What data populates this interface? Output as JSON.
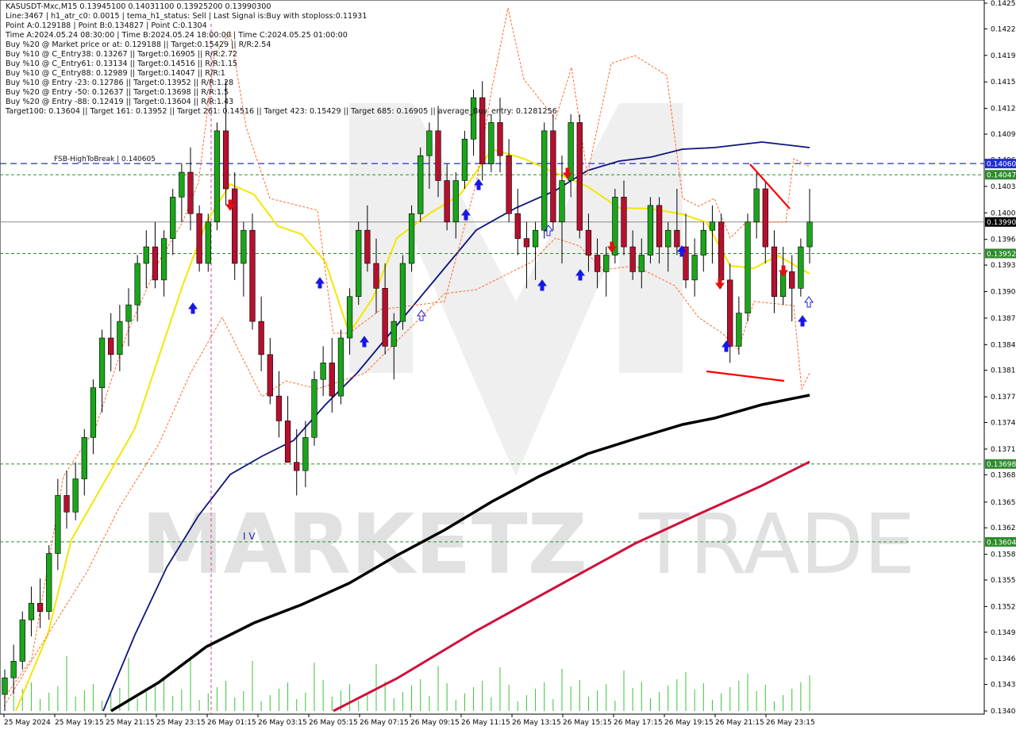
{
  "header": {
    "lines": [
      "KASUSDT-Mxc,M15  0.13945100 0.14031100 0.13925200 0.13990300",
      "Line:3467  |  h1_atr_c0: 0.0015  |  tema_h1_status: Sell  |  Last Signal is:Buy with stoploss:0.11931",
      "Point A:0.129188  |  Point B:0.134827  |  Point C:0.1304",
      "Time A:2024.05.24 08:30:00  |  Time B:2024.05.24 18:00:00  |  Time C:2024.05.25 01:00:00",
      "Buy %20 @ Market price or at: 0.129188  ||  Target:0.15429  ||  R/R:2.54",
      "Buy %10 @ C_Entry38: 0.13267  ||  Target:0.16905  ||  R/R:2.72",
      "Buy %10 @ C_Entry61: 0.13134  ||  Target:0.14516  ||  R/R:1.15",
      "Buy %10 @ C_Entry88: 0.12989  ||  Target:0.14047  ||  R/R:1",
      "Buy %10 @ Entry -23: 0.12786  ||  Target:0.13952  ||  R/R:1.28",
      "Buy %20 @ Entry -50: 0.12637  ||  Target:0.13698  ||  R/R:1.5",
      "Buy %20 @ Entry -88: 0.12419  ||  Target:0.13604  ||  R/R:1.43",
      "Target100: 0.13604  ||  Target 161: 0.13952  ||  Target 261: 0.14516  ||  Target 423: 0.15429  ||  Target 685: 0.16905  ||  average_Buy_entry: 0.1281256"
    ]
  },
  "labels": {
    "fsb": "FSB-HighToBreak  |  0.140605",
    "wave": "I V",
    "watermark_left": "MARKETZ",
    "watermark_right": "TRADE"
  },
  "chart_data": {
    "type": "candlestick",
    "symbol": "KASUSDT-Mxc",
    "timeframe": "M15",
    "ohlc": {
      "open": 0.139451,
      "high": 0.140311,
      "low": 0.139252,
      "close": 0.139903
    },
    "y_range": [
      0.134,
      0.14254
    ],
    "y_ticks": [
      "0.14254",
      "0.14223",
      "0.14191",
      "0.14159",
      "0.14127",
      "0.14096",
      "0.14065",
      "0.14033",
      "0.14001",
      "0.13969",
      "0.13938",
      "0.13906",
      "0.13874",
      "0.13842",
      "0.13811",
      "0.13779",
      "0.13748",
      "0.13716",
      "0.13685",
      "0.13652",
      "0.13621",
      "0.13589",
      "0.13558",
      "0.13526",
      "0.13495",
      "0.13463",
      "0.13432",
      "0.13400"
    ],
    "x_ticks": [
      "25 May 2024",
      "25 May 19:15",
      "25 May 21:15",
      "25 May 23:15",
      "26 May 01:15",
      "26 May 03:15",
      "26 May 05:15",
      "26 May 07:15",
      "26 May 09:15",
      "26 May 11:15",
      "26 May 13:15",
      "26 May 15:15",
      "26 May 17:15",
      "26 May 19:15",
      "26 May 21:15",
      "26 May 23:15"
    ],
    "levels": [
      {
        "name": "FSB-HighToBreak",
        "value": 0.140605,
        "label": "0.14060",
        "color": "#1f2fd6",
        "style": "dashed"
      },
      {
        "name": "target-685",
        "value": 0.14047,
        "label": "0.14047",
        "color": "#2e8b2e",
        "style": "dotted"
      },
      {
        "name": "current-price",
        "value": 0.1399,
        "label": "0.13990",
        "color": "#000000",
        "style": "solid"
      },
      {
        "name": "target-261",
        "value": 0.13952,
        "label": "0.13952",
        "color": "#2e8b2e",
        "style": "dotted"
      },
      {
        "name": "target-161",
        "value": 0.13698,
        "label": "0.13698",
        "color": "#2e8b2e",
        "style": "dotted"
      },
      {
        "name": "target-100",
        "value": 0.13604,
        "label": "0.13604",
        "color": "#2e8b2e",
        "style": "dotted"
      }
    ],
    "candles": [
      [
        0.1342,
        0.1345,
        0.134,
        0.1344
      ],
      [
        0.1344,
        0.1348,
        0.1342,
        0.1346
      ],
      [
        0.1346,
        0.1352,
        0.1345,
        0.1351
      ],
      [
        0.1351,
        0.1355,
        0.1349,
        0.1353
      ],
      [
        0.1353,
        0.1356,
        0.135,
        0.1352
      ],
      [
        0.1352,
        0.136,
        0.1351,
        0.1359
      ],
      [
        0.1359,
        0.1368,
        0.1357,
        0.1366
      ],
      [
        0.1366,
        0.1369,
        0.1362,
        0.1364
      ],
      [
        0.1364,
        0.137,
        0.1363,
        0.1368
      ],
      [
        0.1368,
        0.1374,
        0.1366,
        0.1373
      ],
      [
        0.1373,
        0.138,
        0.1371,
        0.1379
      ],
      [
        0.1379,
        0.1386,
        0.1376,
        0.1385
      ],
      [
        0.1385,
        0.1388,
        0.1381,
        0.1383
      ],
      [
        0.1383,
        0.1389,
        0.1381,
        0.1387
      ],
      [
        0.1387,
        0.1391,
        0.1384,
        0.1389
      ],
      [
        0.1389,
        0.1395,
        0.1387,
        0.1394
      ],
      [
        0.1394,
        0.1398,
        0.1391,
        0.1396
      ],
      [
        0.1396,
        0.1399,
        0.1391,
        0.1392
      ],
      [
        0.1392,
        0.1398,
        0.139,
        0.1397
      ],
      [
        0.1397,
        0.1403,
        0.1395,
        0.1402
      ],
      [
        0.1402,
        0.1406,
        0.1399,
        0.1405
      ],
      [
        0.1405,
        0.1408,
        0.1398,
        0.14
      ],
      [
        0.14,
        0.1401,
        0.1393,
        0.1394
      ],
      [
        0.1394,
        0.14,
        0.1393,
        0.1399
      ],
      [
        0.1399,
        0.1411,
        0.1398,
        0.141
      ],
      [
        0.141,
        0.1416,
        0.1401,
        0.1403
      ],
      [
        0.1403,
        0.1405,
        0.1392,
        0.1394
      ],
      [
        0.1394,
        0.1399,
        0.139,
        0.1398
      ],
      [
        0.1398,
        0.14,
        0.1386,
        0.1387
      ],
      [
        0.1387,
        0.139,
        0.1381,
        0.1383
      ],
      [
        0.1383,
        0.1385,
        0.1377,
        0.1378
      ],
      [
        0.1378,
        0.1381,
        0.1373,
        0.1375
      ],
      [
        0.1375,
        0.1378,
        0.137,
        0.137
      ],
      [
        0.137,
        0.1374,
        0.1366,
        0.1369
      ],
      [
        0.1369,
        0.1375,
        0.1367,
        0.1373
      ],
      [
        0.1373,
        0.1381,
        0.1372,
        0.138
      ],
      [
        0.138,
        0.1384,
        0.1378,
        0.1382
      ],
      [
        0.1382,
        0.1385,
        0.1376,
        0.1378
      ],
      [
        0.1378,
        0.1386,
        0.1377,
        0.1385
      ],
      [
        0.1385,
        0.1391,
        0.1383,
        0.139
      ],
      [
        0.139,
        0.1399,
        0.1389,
        0.1398
      ],
      [
        0.1398,
        0.1401,
        0.1393,
        0.1394
      ],
      [
        0.1394,
        0.1397,
        0.1388,
        0.1391
      ],
      [
        0.1391,
        0.1394,
        0.1383,
        0.1384
      ],
      [
        0.1384,
        0.1388,
        0.138,
        0.1387
      ],
      [
        0.1387,
        0.1395,
        0.1386,
        0.1394
      ],
      [
        0.1394,
        0.1401,
        0.1393,
        0.14
      ],
      [
        0.14,
        0.1408,
        0.1399,
        0.1407
      ],
      [
        0.1407,
        0.1411,
        0.1403,
        0.141
      ],
      [
        0.141,
        0.1413,
        0.1402,
        0.1404
      ],
      [
        0.1404,
        0.1406,
        0.1398,
        0.1399
      ],
      [
        0.1399,
        0.1405,
        0.1397,
        0.1404
      ],
      [
        0.1404,
        0.141,
        0.1403,
        0.1409
      ],
      [
        0.1409,
        0.1415,
        0.1407,
        0.1414
      ],
      [
        0.1414,
        0.1416,
        0.1404,
        0.1406
      ],
      [
        0.1406,
        0.1412,
        0.1405,
        0.1411
      ],
      [
        0.1411,
        0.1414,
        0.1405,
        0.1407
      ],
      [
        0.1407,
        0.1409,
        0.1399,
        0.14
      ],
      [
        0.14,
        0.1403,
        0.1395,
        0.1397
      ],
      [
        0.1397,
        0.1399,
        0.1391,
        0.1396
      ],
      [
        0.1396,
        0.1399,
        0.1392,
        0.1398
      ],
      [
        0.1398,
        0.1411,
        0.1397,
        0.141
      ],
      [
        0.141,
        0.1412,
        0.1398,
        0.1399
      ],
      [
        0.1399,
        0.1407,
        0.1394,
        0.1404
      ],
      [
        0.1404,
        0.1412,
        0.1402,
        0.1411
      ],
      [
        0.1411,
        0.1412,
        0.1397,
        0.1398
      ],
      [
        0.1398,
        0.14,
        0.1393,
        0.1395
      ],
      [
        0.1395,
        0.1397,
        0.1391,
        0.1393
      ],
      [
        0.1393,
        0.1396,
        0.139,
        0.1395
      ],
      [
        0.1395,
        0.1403,
        0.1394,
        0.1402
      ],
      [
        0.1402,
        0.1404,
        0.1395,
        0.1396
      ],
      [
        0.1396,
        0.1398,
        0.1392,
        0.1393
      ],
      [
        0.1393,
        0.1397,
        0.1391,
        0.1395
      ],
      [
        0.1395,
        0.1402,
        0.1394,
        0.1401
      ],
      [
        0.1401,
        0.1402,
        0.1394,
        0.1396
      ],
      [
        0.1396,
        0.1399,
        0.1393,
        0.1398
      ],
      [
        0.1398,
        0.1403,
        0.1395,
        0.1396
      ],
      [
        0.1396,
        0.14,
        0.1391,
        0.1392
      ],
      [
        0.1392,
        0.1397,
        0.139,
        0.1395
      ],
      [
        0.1395,
        0.1399,
        0.1393,
        0.1398
      ],
      [
        0.1398,
        0.1401,
        0.1394,
        0.1399
      ],
      [
        0.1399,
        0.14,
        0.1391,
        0.1392
      ],
      [
        0.1392,
        0.1394,
        0.1382,
        0.1384
      ],
      [
        0.1384,
        0.139,
        0.1383,
        0.1388
      ],
      [
        0.1388,
        0.14,
        0.1387,
        0.1399
      ],
      [
        0.1399,
        0.1405,
        0.1397,
        0.1403
      ],
      [
        0.1403,
        0.1404,
        0.1394,
        0.1396
      ],
      [
        0.1396,
        0.1398,
        0.1388,
        0.139
      ],
      [
        0.139,
        0.1396,
        0.1389,
        0.1393
      ],
      [
        0.1393,
        0.1395,
        0.1387,
        0.1391
      ],
      [
        0.1391,
        0.1397,
        0.139,
        0.1396
      ],
      [
        0.1396,
        0.1403,
        0.1394,
        0.1399
      ]
    ]
  }
}
